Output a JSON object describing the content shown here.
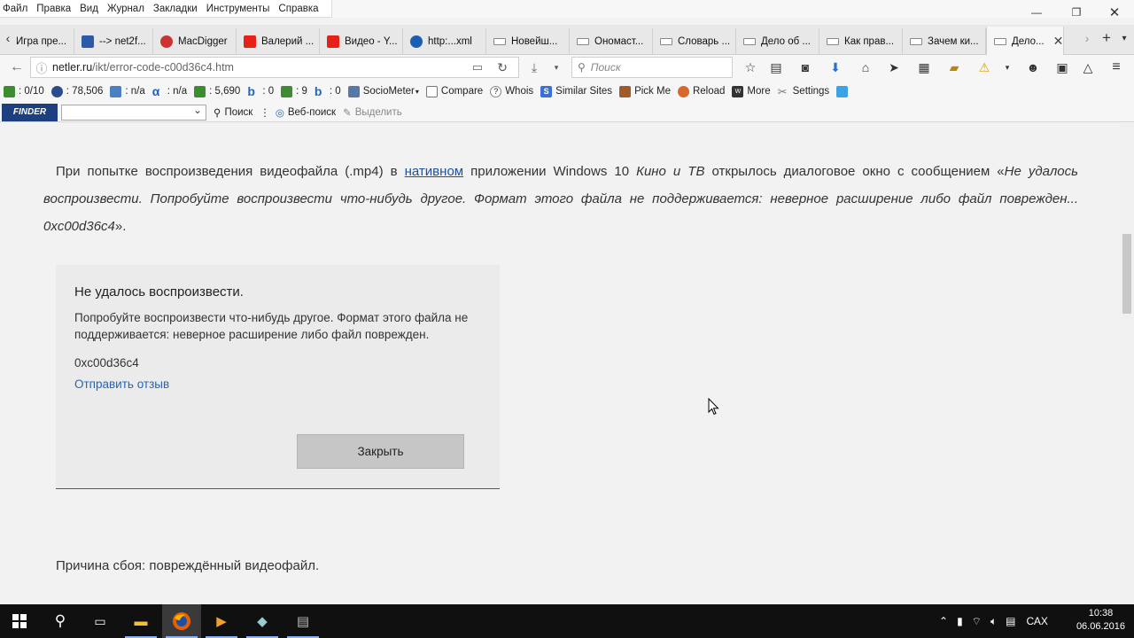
{
  "menu": [
    "Файл",
    "Правка",
    "Вид",
    "Журнал",
    "Закладки",
    "Инструменты",
    "Справка"
  ],
  "tabs": [
    {
      "label": "Игра пре...",
      "icon": "doc"
    },
    {
      "label": "--> net2f...",
      "icon": "net"
    },
    {
      "label": "MacDigger",
      "icon": "md"
    },
    {
      "label": "Валерий ...",
      "icon": "yt"
    },
    {
      "label": "Видео - Y...",
      "icon": "yt"
    },
    {
      "label": "http:...xml",
      "icon": "globe"
    },
    {
      "label": "Новейш...",
      "icon": "doc"
    },
    {
      "label": "Ономаст...",
      "icon": "doc"
    },
    {
      "label": "Словарь ...",
      "icon": "doc"
    },
    {
      "label": "Дело об ...",
      "icon": "doc"
    },
    {
      "label": "Как прав...",
      "icon": "doc"
    },
    {
      "label": "Зачем ки...",
      "icon": "doc"
    },
    {
      "label": "Дело...",
      "icon": "doc"
    }
  ],
  "nav": {
    "url_host": "netler.ru",
    "url_path": "/ikt/error-code-c00d36c4.htm",
    "search_placeholder": "Поиск"
  },
  "seo": [
    {
      "label": ": 0/10",
      "color": "#3c8d2f"
    },
    {
      "label": ": 78,506",
      "color": "#2b4c8c"
    },
    {
      "label": ": n/a",
      "color": "#4a7fc1"
    },
    {
      "label": ": n/a",
      "color": "#1d5fc7"
    },
    {
      "label": ": 5,690",
      "color": "#3c8d2f"
    },
    {
      "label": ": 0",
      "color": "#2467b5"
    },
    {
      "label": ": 9",
      "color": "#3c8d2f"
    },
    {
      "label": ": 0",
      "color": "#2467b5"
    },
    {
      "label": "SocioMeter",
      "color": "#5577aa"
    },
    {
      "label": "Compare",
      "color": "#777777"
    },
    {
      "label": "Whois",
      "color": "#888888"
    },
    {
      "label": "Similar Sites",
      "color": "#3a6fd8"
    },
    {
      "label": "Pick Me",
      "color": "#a05a2c"
    },
    {
      "label": "Reload",
      "color": "#d9662b"
    },
    {
      "label": "More",
      "color": "#333333"
    },
    {
      "label": "Settings",
      "color": "#777777"
    }
  ],
  "finder": {
    "logo": "FINDER",
    "search": "Поиск",
    "web_search": "Веб-поиск",
    "highlight": "Выделить"
  },
  "article": {
    "p1_a": "При попытке воспроизведения видеофайла (.mp4) в ",
    "p1_link": "нативном",
    "p1_b": " приложении Windows 10 ",
    "p1_app": "Кино и ТВ",
    "p1_c": " открылось диалоговое окно с сообщением «",
    "p1_quote": "Не удалось воспроизвести. Попробуйте воспроизвести что-нибудь другое. Формат этого файла не поддерживается: неверное расширение либо файл поврежден... 0xc00d36c4",
    "p1_d": "».",
    "p2": "Причина сбоя: повреждённый видеофайл."
  },
  "dialog": {
    "title": "Не удалось воспроизвести.",
    "message": "Попробуйте воспроизвести что-нибудь другое. Формат этого файла не поддерживается: неверное расширение либо файл поврежден.",
    "code": "0xc00d36c4",
    "feedback": "Отправить отзыв",
    "close": "Закрыть"
  },
  "taskbar": {
    "lang": "САХ",
    "time": "10:38",
    "date": "06.06.2016"
  }
}
